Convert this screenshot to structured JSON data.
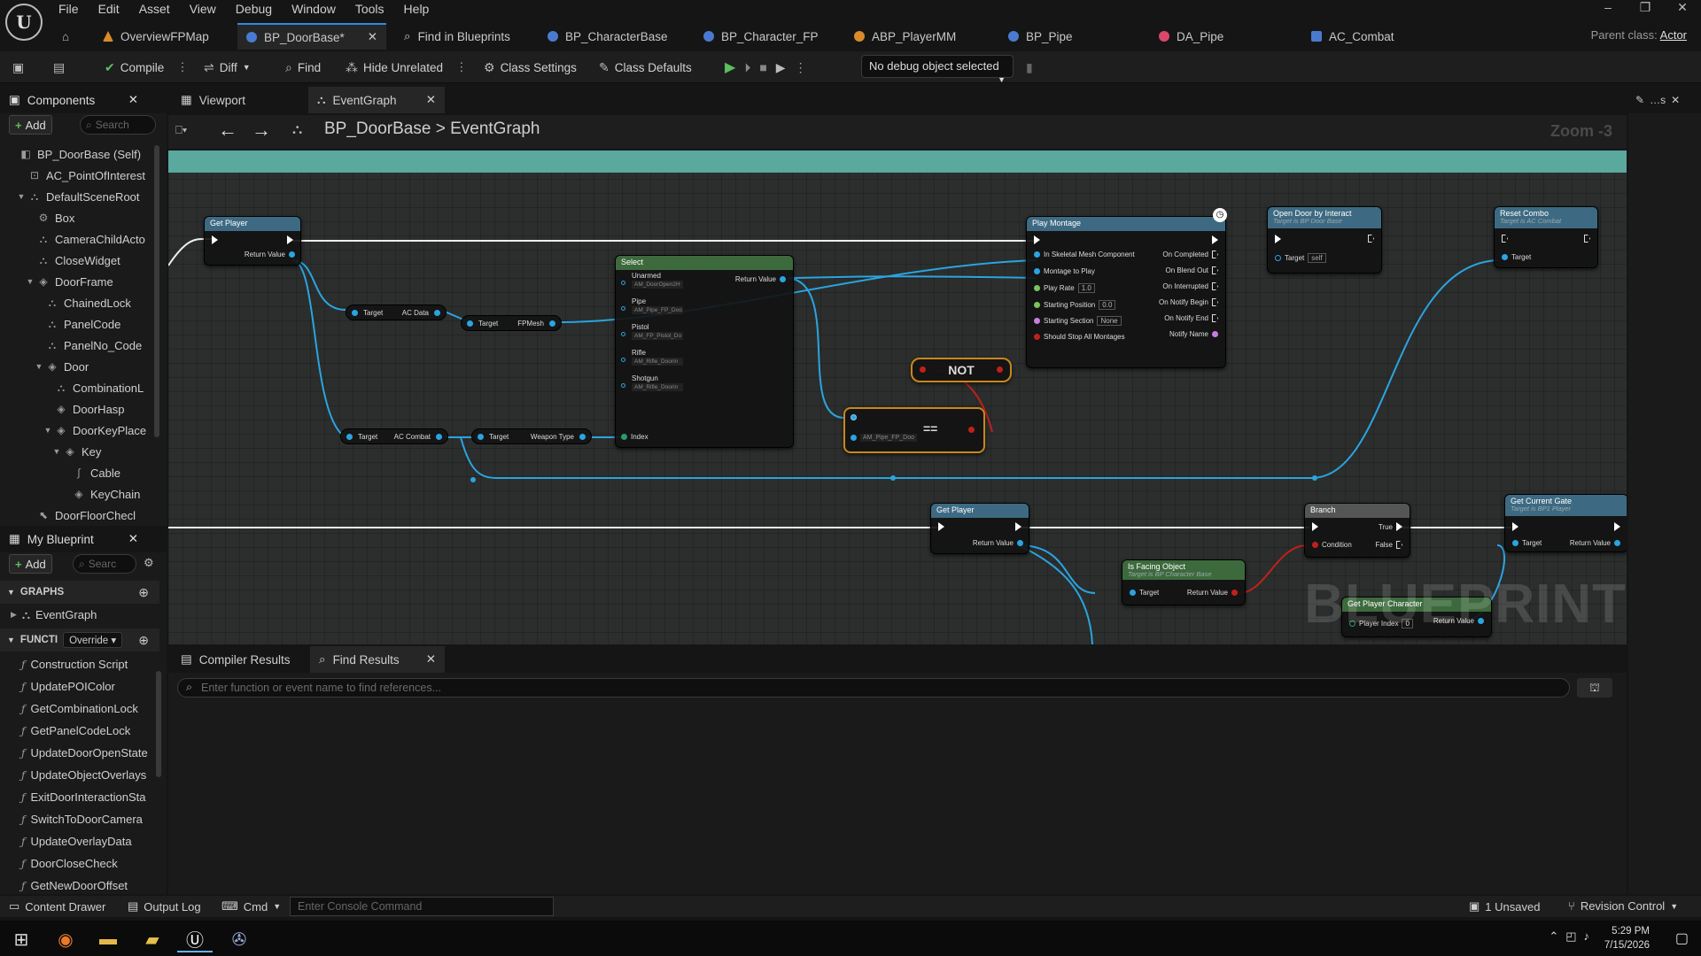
{
  "menu": [
    "File",
    "Edit",
    "Asset",
    "View",
    "Debug",
    "Window",
    "Tools",
    "Help"
  ],
  "logo": "U",
  "doc_tabs": [
    {
      "label": "OverviewFPMap",
      "color": "#d98a2b"
    },
    {
      "label": "BP_DoorBase*",
      "color": "#4a7ad0"
    },
    {
      "label": "Find in Blueprints",
      "color": "#bbbbbb"
    },
    {
      "label": "BP_CharacterBase",
      "color": "#4a7ad0"
    },
    {
      "label": "BP_Character_FP",
      "color": "#4a7ad0"
    },
    {
      "label": "ABP_PlayerMM",
      "color": "#d98a2b"
    },
    {
      "label": "BP_Pipe",
      "color": "#4a7ad0"
    },
    {
      "label": "DA_Pipe",
      "color": "#d9476a"
    },
    {
      "label": "AC_Combat",
      "color": "#4a7ad0"
    }
  ],
  "parent_class": {
    "label": "Parent class:",
    "value": "Actor"
  },
  "toolbar": {
    "compile": "Compile",
    "diff": "Diff",
    "find": "Find",
    "hide_unrelated": "Hide Unrelated",
    "class_settings": "Class Settings",
    "class_defaults": "Class Defaults",
    "debug_select": "No debug object selected"
  },
  "components": {
    "title": "Components",
    "add": "Add",
    "search": "Search",
    "tree": [
      {
        "label": "BP_DoorBase (Self)",
        "level": 0,
        "icon": "◧",
        "tw": ""
      },
      {
        "label": "AC_PointOfInterest",
        "level": 1,
        "icon": "⊡",
        "tw": ""
      },
      {
        "label": "DefaultSceneRoot",
        "level": 1,
        "icon": "⛬",
        "tw": "▼"
      },
      {
        "label": "Box",
        "level": 2,
        "icon": "⚙",
        "tw": ""
      },
      {
        "label": "CameraChildActo",
        "level": 2,
        "icon": "⛬",
        "tw": ""
      },
      {
        "label": "CloseWidget",
        "level": 2,
        "icon": "⛬",
        "tw": ""
      },
      {
        "label": "DoorFrame",
        "level": 2,
        "icon": "◈",
        "tw": "▼"
      },
      {
        "label": "ChainedLock",
        "level": 3,
        "icon": "⛬",
        "tw": ""
      },
      {
        "label": "PanelCode",
        "level": 3,
        "icon": "⛬",
        "tw": ""
      },
      {
        "label": "PanelNo_Code",
        "level": 3,
        "icon": "⛬",
        "tw": ""
      },
      {
        "label": "Door",
        "level": 3,
        "icon": "◈",
        "tw": "▼"
      },
      {
        "label": "CombinationL",
        "level": 4,
        "icon": "⛬",
        "tw": ""
      },
      {
        "label": "DoorHasp",
        "level": 4,
        "icon": "◈",
        "tw": ""
      },
      {
        "label": "DoorKeyPlace",
        "level": 4,
        "icon": "◈",
        "tw": "▼"
      },
      {
        "label": "Key",
        "level": 5,
        "icon": "◈",
        "tw": "▼"
      },
      {
        "label": "Cable",
        "level": 6,
        "icon": "∫",
        "tw": ""
      },
      {
        "label": "KeyChain",
        "level": 6,
        "icon": "◈",
        "tw": ""
      },
      {
        "label": "DoorFloorChecl",
        "level": 2,
        "icon": "⬉",
        "tw": ""
      }
    ]
  },
  "my_blueprint": {
    "title": "My Blueprint",
    "add": "Add",
    "search": "Searc",
    "graphs_label": "GRAPHS",
    "graphs": [
      "EventGraph"
    ],
    "functions_label": "FUNCTI",
    "override": "Override",
    "functions": [
      "Construction Script",
      "UpdatePOIColor",
      "GetCombinationLock",
      "GetPanelCodeLock",
      "UpdateDoorOpenState",
      "UpdateObjectOverlays",
      "ExitDoorInteractionSta",
      "SwitchToDoorCamera",
      "UpdateOverlayData",
      "DoorCloseCheck",
      "GetNewDoorOffset"
    ]
  },
  "editor_tabs": [
    "Viewport",
    "EventGraph"
  ],
  "breadcrumb": {
    "root": "BP_DoorBase",
    "sep": ">",
    "leaf": "EventGraph"
  },
  "zoom": "Zoom -3",
  "watermark": "BLUEPRINT",
  "nodes": {
    "get_player1": {
      "title": "Get Player",
      "out": "Return Value"
    },
    "pill_acdata": {
      "a": "Target",
      "b": "AC Data"
    },
    "pill_fpmesh": {
      "a": "Target",
      "b": "FPMesh"
    },
    "pill_accombat": {
      "a": "Target",
      "b": "AC Combat"
    },
    "pill_weapon": {
      "a": "Target",
      "b": "Weapon Type"
    },
    "select": {
      "title": "Select",
      "out": "Return Value",
      "index": "Index",
      "options": [
        {
          "label": "Unarmed",
          "value": "AM_DoorOpen2H"
        },
        {
          "label": "Pipe",
          "value": "AM_Pipe_FP_Doo"
        },
        {
          "label": "Pistol",
          "value": "AM_FP_Pistol_Do"
        },
        {
          "label": "Rifle",
          "value": "AM_Rifle_Doorin"
        },
        {
          "label": "Shotgun",
          "value": "AM_Rifle_Doorin"
        }
      ]
    },
    "not": "NOT",
    "equal": {
      "op": "==",
      "value": "AM_Pipe_FP_Doo"
    },
    "play_montage": {
      "title": "Play Montage",
      "inputs": [
        "In Skeletal Mesh Component",
        "Montage to Play",
        "Play Rate",
        "Starting Position",
        "Starting Section",
        "Should Stop All Montages"
      ],
      "input_values": {
        "rate": "1.0",
        "pos": "0.0",
        "section": "None"
      },
      "outputs": [
        "On Completed",
        "On Blend Out",
        "On Interrupted",
        "On Notify Begin",
        "On Notify End",
        "Notify Name"
      ]
    },
    "open_door": {
      "title": "Open Door by Interact",
      "sub": "Target is BP Door Base",
      "target": "Target",
      "value": "self"
    },
    "reset_combo": {
      "title": "Reset Combo",
      "sub": "Target is AC Combat",
      "target": "Target"
    },
    "get_player2": {
      "title": "Get Player",
      "out": "Return Value"
    },
    "branch": {
      "title": "Branch",
      "cond": "Condition",
      "t": "True",
      "f": "False"
    },
    "facing": {
      "title": "Is Facing Object",
      "sub": "Target is BP Character Base",
      "target": "Target",
      "out": "Return Value"
    },
    "get_gate": {
      "title": "Get Current Gate",
      "sub": "Target is BP1 Player",
      "target": "Target",
      "out": "Return Value"
    },
    "get_char": {
      "title": "Get Player Character",
      "idx": "Player Index",
      "idx_val": "0",
      "out": "Return Value"
    }
  },
  "bottom_tabs": [
    "Compiler Results",
    "Find Results"
  ],
  "find_placeholder": "Enter function or event name to find references...",
  "status": {
    "content_drawer": "Content Drawer",
    "output_log": "Output Log",
    "cmd": "Cmd",
    "console_placeholder": "Enter Console Command",
    "unsaved": "1 Unsaved",
    "revision": "Revision Control"
  },
  "clock": {
    "time": "5:29 PM",
    "date": "7/15/2026"
  }
}
